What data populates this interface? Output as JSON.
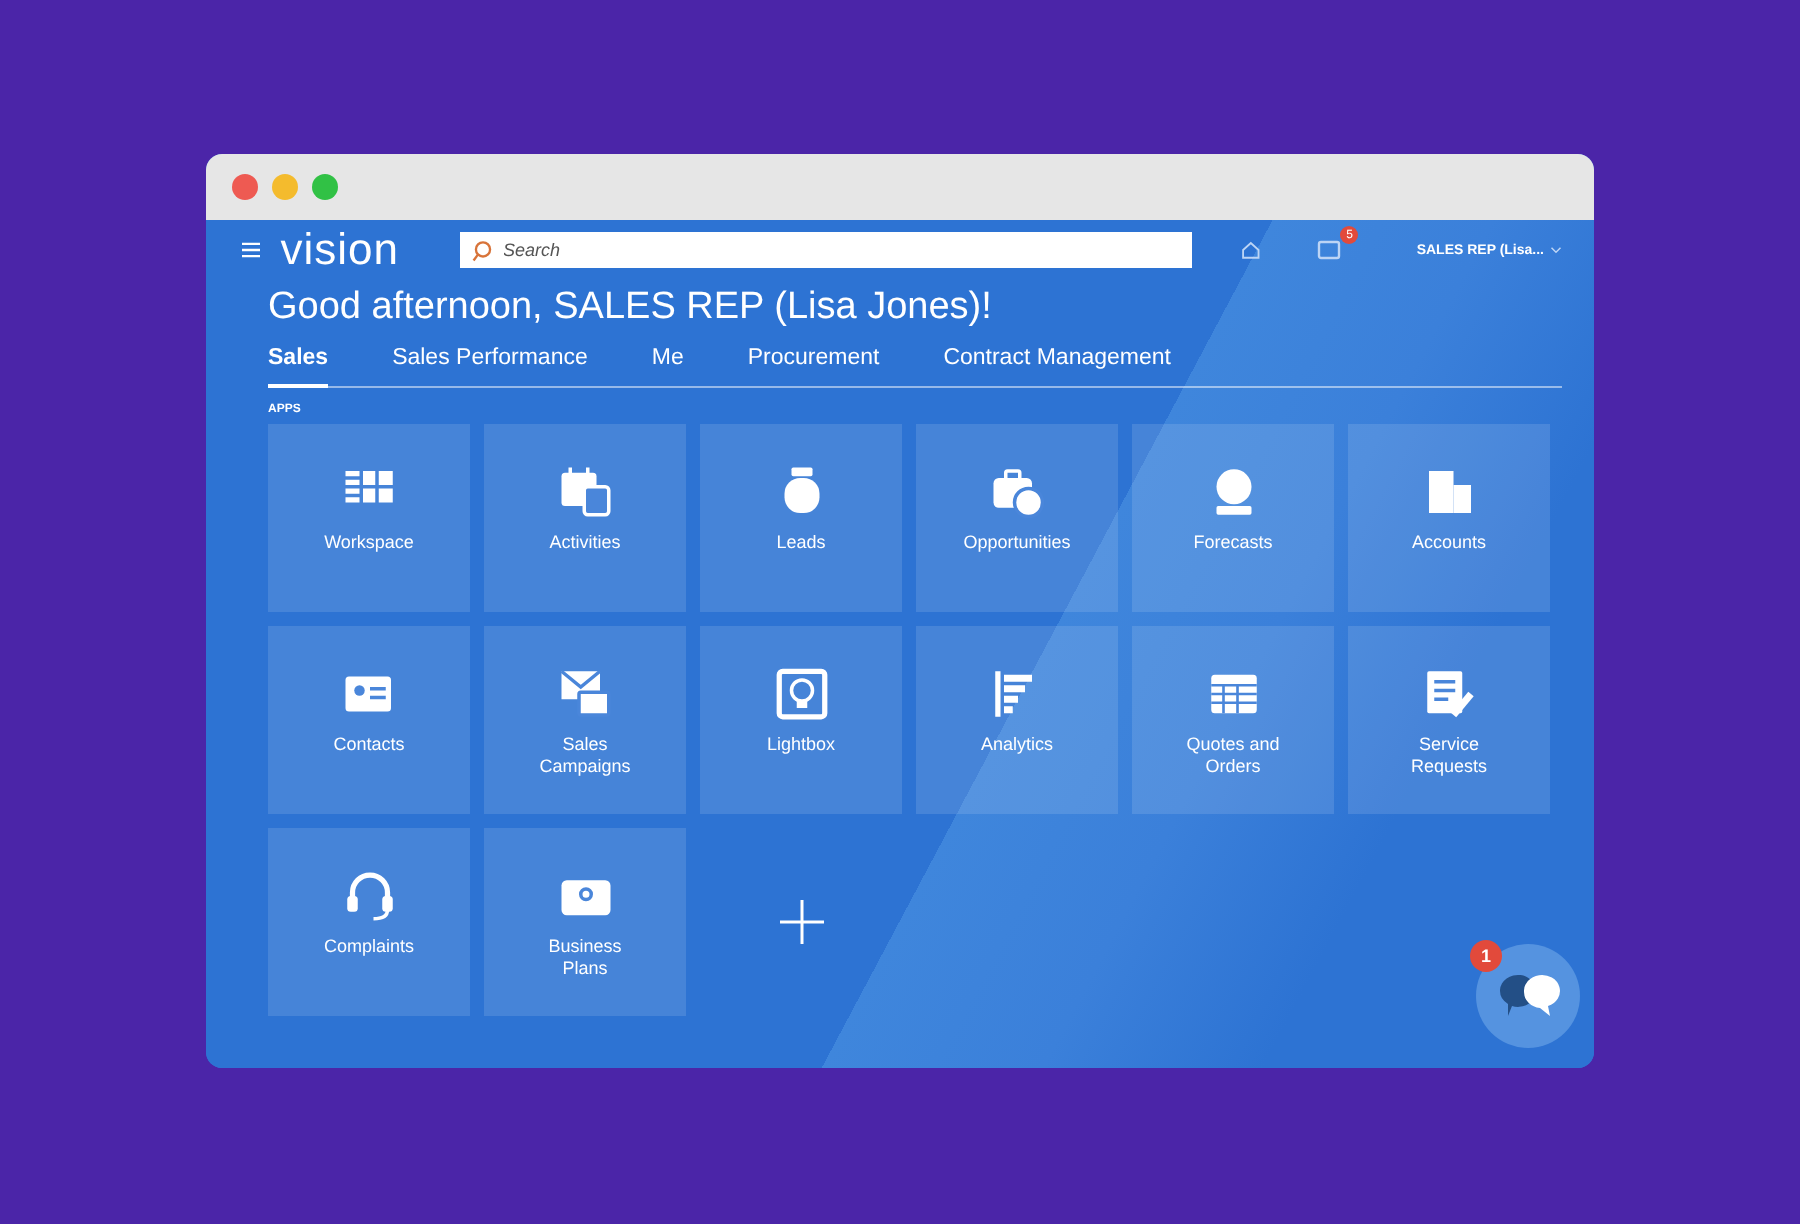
{
  "header": {
    "logo": "vision",
    "search": {
      "placeholder": "Search"
    },
    "notification_count": "5",
    "user": "SALES REP (Lisa..."
  },
  "greeting": "Good afternoon, SALES REP (Lisa Jones)!",
  "tabs": [
    {
      "label": "Sales",
      "selected": true
    },
    {
      "label": "Sales Performance",
      "selected": false
    },
    {
      "label": "Me",
      "selected": false
    },
    {
      "label": "Procurement",
      "selected": false
    },
    {
      "label": "Contract Management",
      "selected": false
    }
  ],
  "section_title": "APPS",
  "apps": [
    {
      "label": "Workspace"
    },
    {
      "label": "Activities"
    },
    {
      "label": "Leads"
    },
    {
      "label": "Opportunities"
    },
    {
      "label": "Forecasts"
    },
    {
      "label": "Accounts"
    },
    {
      "label": "Contacts"
    },
    {
      "label": "Sales Campaigns"
    },
    {
      "label": "Lightbox"
    },
    {
      "label": "Analytics"
    },
    {
      "label": "Quotes and Orders"
    },
    {
      "label": "Service Requests"
    },
    {
      "label": "Complaints"
    },
    {
      "label": "Business Plans"
    }
  ],
  "chat_badge": "1"
}
